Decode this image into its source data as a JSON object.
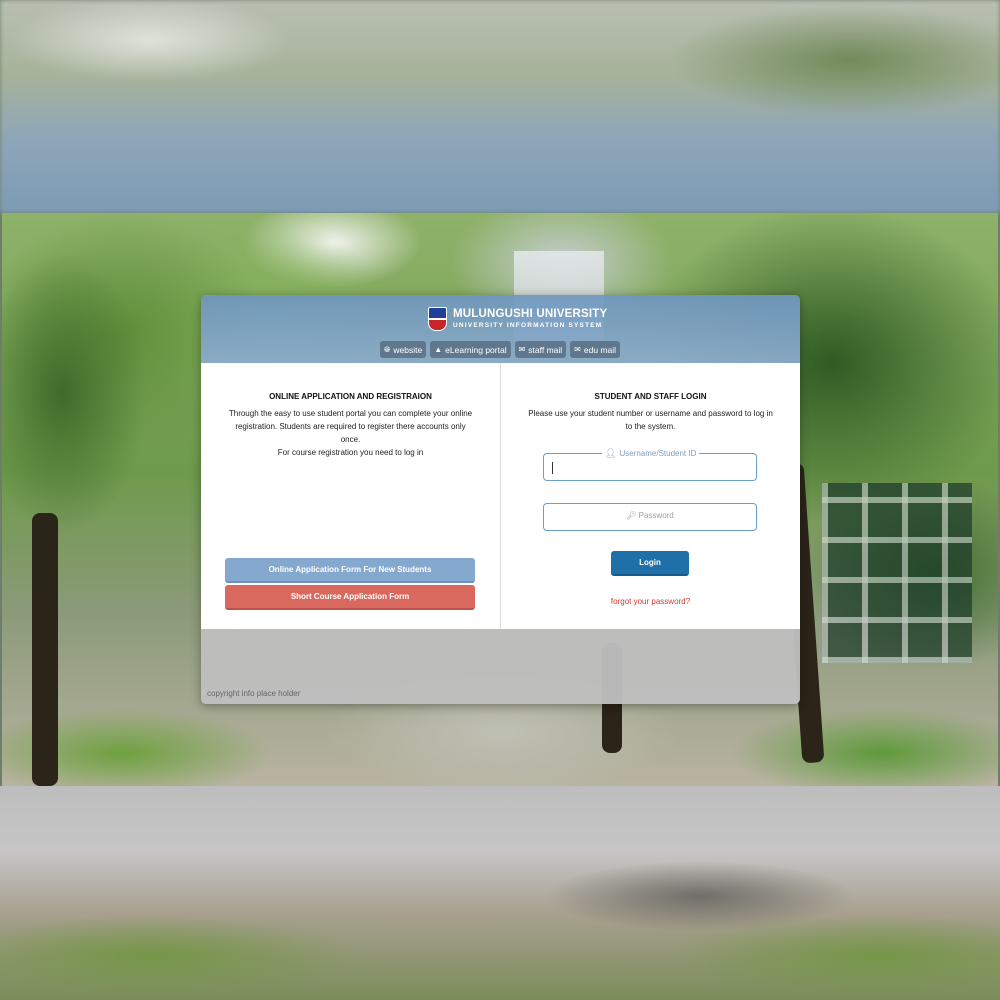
{
  "header": {
    "university_name": "MULUNGUSHI UNIVERSITY",
    "system_name": "UNIVERSITY INFORMATION SYSTEM",
    "nav_links": [
      {
        "label": "website",
        "icon": "globe-icon"
      },
      {
        "label": "eLearning portal",
        "icon": "graduation-cap-icon"
      },
      {
        "label": "staff mail",
        "icon": "envelope-icon"
      },
      {
        "label": "edu mail",
        "icon": "envelope-icon"
      }
    ]
  },
  "application": {
    "title": "ONLINE APPLICATION AND REGISTRAION",
    "description": "Through the easy to use student portal you can complete your online registration. Students are required to register there accounts only once.",
    "note": "For course registration you need to log in",
    "new_students_button": "Online Application Form For New Students",
    "short_course_button": "Short Course Application Form"
  },
  "login": {
    "title": "STUDENT AND STAFF LOGIN",
    "description": "Please use your student number or username and password to log in to the system.",
    "username_label": "Username/Student ID",
    "username_value": "",
    "password_placeholder": "Password",
    "login_button": "Login",
    "forgot_link": "forgot your password?"
  },
  "footer": {
    "copyright": "copyright info place holder"
  },
  "colors": {
    "accent_blue": "#1f6fa8",
    "app_button_blue": "#85a8cf",
    "app_button_red": "#d9695f",
    "link_red": "#d23b2c"
  }
}
